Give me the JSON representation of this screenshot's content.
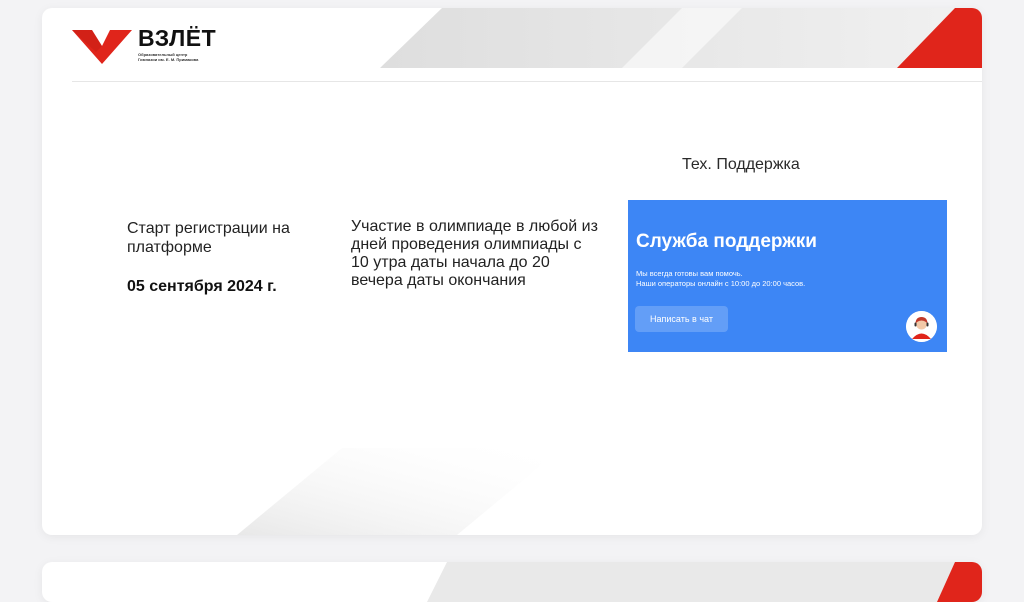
{
  "brand": {
    "name": "ВЗЛЁТ",
    "subtitle_line1": "Образовательный центр",
    "subtitle_line2": "Гимназии им. Е. М. Примакова",
    "accent_red": "#e0251b",
    "logo_icon": "v-checkmark-logo-icon"
  },
  "registration": {
    "label": "Старт регистрации на платформе",
    "date": "05 сентября 2024 г."
  },
  "participation": {
    "text": "Участие в олимпиаде в любой из дней проведения олимпиады с 10 утра даты начала до 20 вечера даты окончания"
  },
  "support": {
    "title": "Тех. Поддержка",
    "widget_title": "Служба поддержки",
    "line1": "Мы всегда готовы вам помочь.",
    "line2": "Наши операторы онлайн с 10:00 до 20:00 часов.",
    "button_label": "Написать в чат",
    "widget_color": "#3d86f5",
    "avatar_icon": "operator-avatar-icon"
  }
}
